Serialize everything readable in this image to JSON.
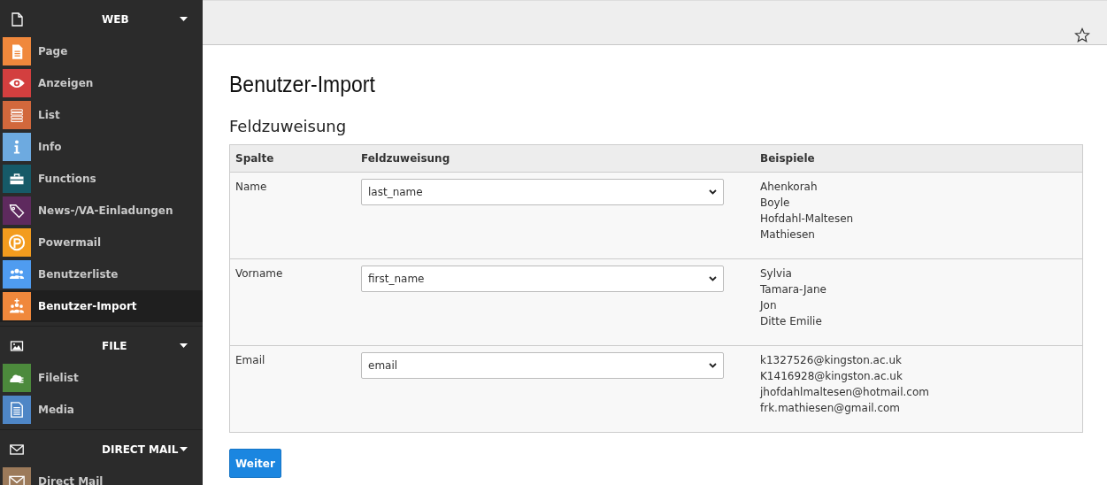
{
  "sidebar": {
    "groups": [
      {
        "title": "WEB",
        "kind": "page-outline",
        "expanded": true,
        "items": [
          {
            "label": "Page",
            "kind": "page",
            "color": "#f0883c",
            "selected": false
          },
          {
            "label": "Anzeigen",
            "kind": "eye",
            "color": "#d33f3f",
            "selected": false
          },
          {
            "label": "List",
            "kind": "list",
            "color": "#d2683c",
            "selected": false
          },
          {
            "label": "Info",
            "kind": "info",
            "color": "#6daae0",
            "selected": false
          },
          {
            "label": "Functions",
            "kind": "toolbox",
            "color": "#165a68",
            "selected": false
          },
          {
            "label": "News-/VA-Einladungen",
            "kind": "tag",
            "color": "#5e2a5e",
            "selected": false
          },
          {
            "label": "Powermail",
            "kind": "p",
            "color": "#f39c1e",
            "selected": false
          },
          {
            "label": "Benutzerliste",
            "kind": "users",
            "color": "#4f9cf0",
            "selected": false
          },
          {
            "label": "Benutzer-Import",
            "kind": "users-plus",
            "color": "#f0883c",
            "selected": true
          }
        ]
      },
      {
        "title": "FILE",
        "kind": "image",
        "expanded": true,
        "items": [
          {
            "label": "Filelist",
            "kind": "cloud",
            "color": "#4c8a3c",
            "selected": false
          },
          {
            "label": "Media",
            "kind": "document",
            "color": "#4e86c6",
            "selected": false
          }
        ]
      },
      {
        "title": "DIRECT MAIL",
        "kind": "envelope",
        "expanded": true,
        "items": [
          {
            "label": "Direct Mail",
            "kind": "envelope-tile",
            "color": "#9c7a5a",
            "selected": false
          }
        ]
      }
    ]
  },
  "page": {
    "title": "Benutzer-Import",
    "section": "Feldzuweisung",
    "table": {
      "columns": [
        "Spalte",
        "Feldzuweisung",
        "Beispiele"
      ],
      "rows": [
        {
          "column": "Name",
          "field": "last_name",
          "examples": [
            "Ahenkorah",
            "Boyle",
            "Hofdahl-Maltesen",
            "Mathiesen"
          ]
        },
        {
          "column": "Vorname",
          "field": "first_name",
          "examples": [
            "Sylvia",
            "Tamara-Jane",
            "Jon",
            "Ditte Emilie"
          ]
        },
        {
          "column": "Email",
          "field": "email",
          "examples": [
            "k1327526@kingston.ac.uk",
            "K1416928@kingston.ac.uk",
            "jhofdahlmaltesen@hotmail.com",
            "frk.mathiesen@gmail.com"
          ]
        }
      ]
    },
    "button": "Weiter"
  }
}
